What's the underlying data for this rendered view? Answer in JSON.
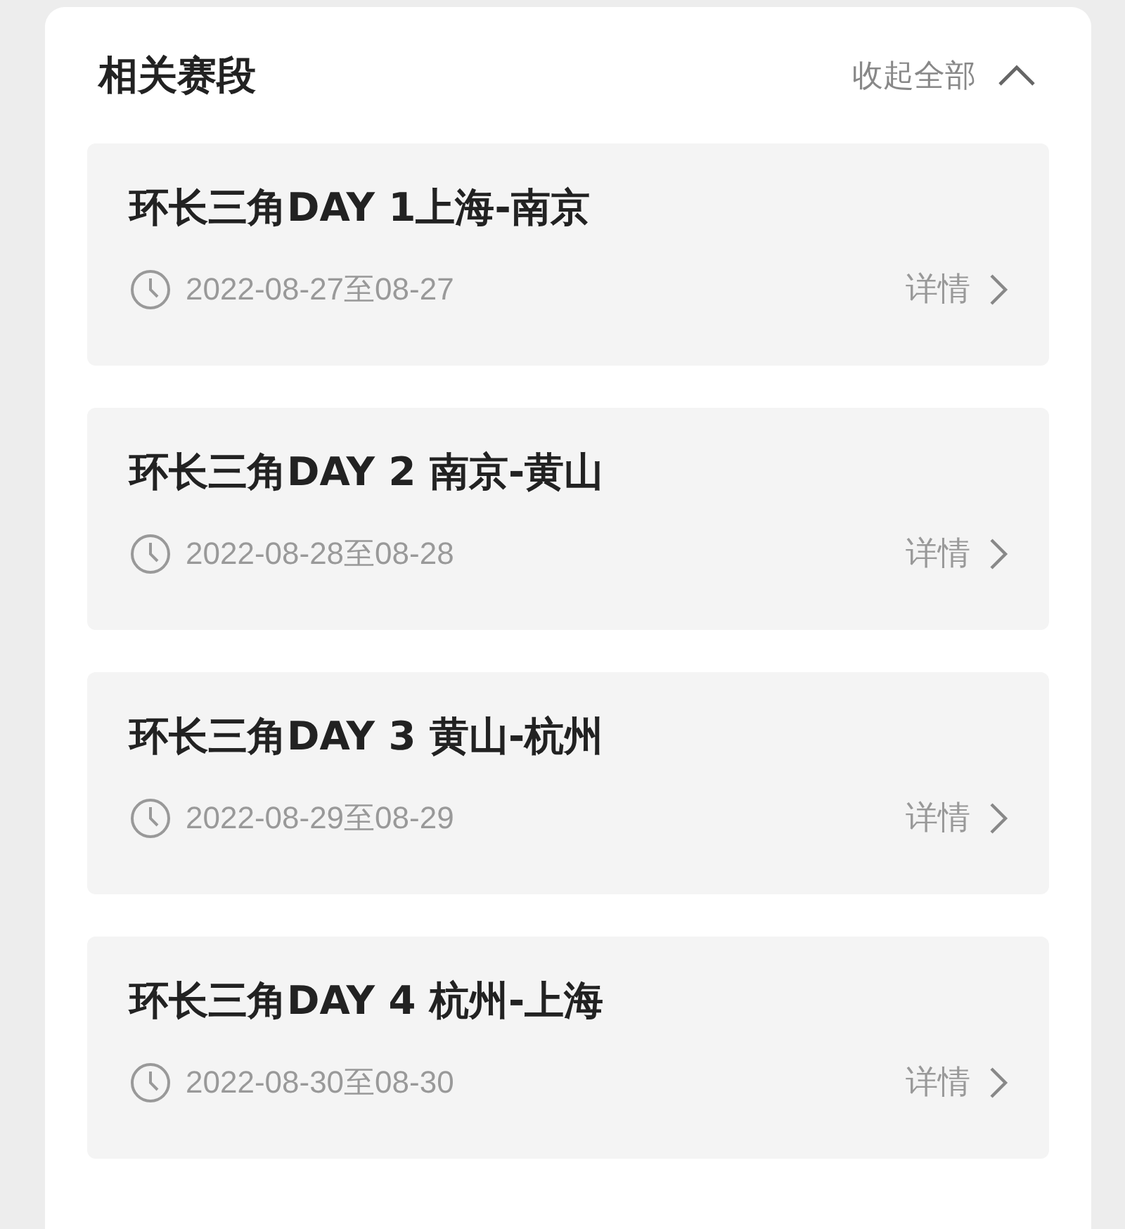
{
  "section": {
    "title": "相关赛段",
    "toggle_label": "收起全部",
    "expanded": true
  },
  "stages": [
    {
      "title": "环长三角DAY 1上海-南京",
      "date": "2022-08-27至08-27",
      "link": "详情"
    },
    {
      "title": "环长三角DAY 2 南京-黄山",
      "date": "2022-08-28至08-28",
      "link": "详情"
    },
    {
      "title": "环长三角DAY 3 黄山-杭州",
      "date": "2022-08-29至08-29",
      "link": "详情"
    },
    {
      "title": "环长三角DAY 4 杭州-上海",
      "date": "2022-08-30至08-30",
      "link": "详情"
    }
  ]
}
